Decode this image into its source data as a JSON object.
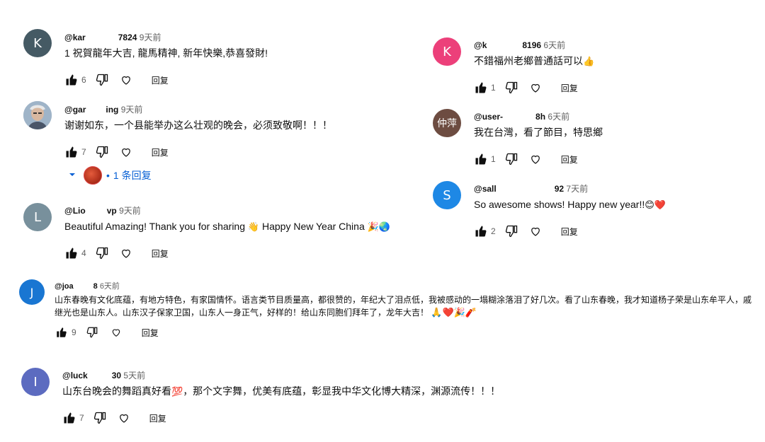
{
  "comments": [
    {
      "avatar_letter": "K",
      "avatar_color": "#455a64",
      "handle": "@kar",
      "handle_tail": "7824",
      "time": "9天前",
      "text": "1 祝賀龍年大吉, 龍馬精神, 新年快樂,恭喜發財!",
      "likes": "6",
      "reply_label": "回复"
    },
    {
      "avatar_letter": "",
      "avatar_color": "#8da2b8",
      "handle": "@gar",
      "handle_tail": "ing",
      "time": "9天前",
      "text": "谢谢如东，一个县能举办这么壮观的晚会，必须致敬啊！！！",
      "likes": "7",
      "reply_label": "回复",
      "replies": "1 条回复"
    },
    {
      "avatar_letter": "L",
      "avatar_color": "#78909c",
      "handle": "@Lio",
      "handle_tail": "vp",
      "time": "9天前",
      "text": "Beautiful Amazing! Thank you for sharing",
      "text_emoji1": "👋",
      "text_mid": "Happy New Year China",
      "text_emoji2": "🎉🌏",
      "likes": "4",
      "reply_label": "回复"
    },
    {
      "avatar_letter": "K",
      "avatar_color": "#ec407a",
      "handle": "@k",
      "handle_tail": "8196",
      "time": "6天前",
      "text": "不錯福州老鄉普通話可以",
      "text_emoji1": "👍",
      "likes": "1",
      "reply_label": "回复"
    },
    {
      "avatar_letter": "仲萍",
      "avatar_color": "#6d4c41",
      "handle": "@user-",
      "handle_tail": "8h",
      "time": "6天前",
      "text": "我在台灣，看了節目，特思鄉",
      "likes": "1",
      "reply_label": "回复"
    },
    {
      "avatar_letter": "S",
      "avatar_color": "#1e88e5",
      "handle": "@sall",
      "handle_tail": "92",
      "time": "7天前",
      "text": "So awesome shows! Happy new year!!",
      "text_emoji1": "😊❤️",
      "likes": "2",
      "reply_label": "回复"
    },
    {
      "avatar_letter": "J",
      "avatar_color": "#1976d2",
      "handle": "@joa",
      "handle_tail": "8",
      "time": "6天前",
      "text": "山东春晚有文化底蕴，有地方特色，有家国情怀。语言类节目质量高，都很赞的，年纪大了泪点低，我被感动的一塌糊涂落泪了好几次。看了山东春晚，我才知道杨子荣是山东牟平人，戚继光也是山东人。山东汉子保家卫国，山东人一身正气，好样的！给山东同胞们拜年了，龙年大吉！",
      "text_emoji1": "🙏❤️🎉🧨",
      "likes": "9",
      "reply_label": "回复"
    },
    {
      "avatar_letter": "I",
      "avatar_color": "#5c6bc0",
      "handle": "@luck",
      "handle_tail": "30",
      "time": "5天前",
      "text": "山东台晚会的舞蹈真好看",
      "text_emoji1": "💯",
      "text_mid": "，那个文字舞，优美有底蕴，彰显我中华文化博大精深，渊源流传！！！",
      "likes": "7",
      "reply_label": "回复"
    }
  ],
  "icons": {
    "like": "thumbs-up-icon",
    "dislike": "thumbs-down-icon",
    "heart": "heart-icon",
    "expand": "chevron-down-icon"
  }
}
